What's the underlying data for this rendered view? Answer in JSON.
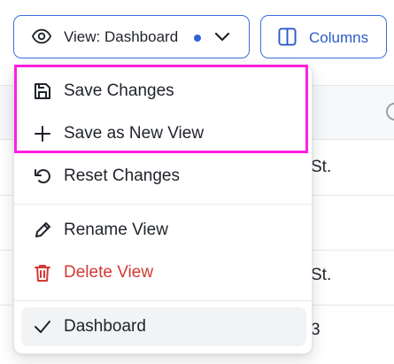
{
  "toolbar": {
    "view_button_label": "View: Dashboard",
    "view_button_icon": "eye-icon",
    "unsaved_dot_color": "#2f64d8",
    "columns_button_label": "Columns",
    "columns_button_icon": "columns-icon"
  },
  "menu": {
    "items": [
      {
        "label": "Save Changes",
        "icon": "save-icon"
      },
      {
        "label": "Save as New View",
        "icon": "plus-icon"
      },
      {
        "label": "Reset Changes",
        "icon": "reset-icon"
      },
      {
        "label": "Rename View",
        "icon": "pencil-icon"
      },
      {
        "label": "Delete View",
        "icon": "trash-icon",
        "color": "#d23a33"
      },
      {
        "label": "Dashboard",
        "icon": "check-icon",
        "selected": true
      }
    ],
    "highlight_color": "#ff1fe0"
  },
  "table": {
    "partial_cells": [
      "St.",
      "St.",
      "3"
    ]
  },
  "colors": {
    "accent": "#3a6fe0",
    "accent_text": "#2a5bc8",
    "danger": "#d23a33"
  }
}
